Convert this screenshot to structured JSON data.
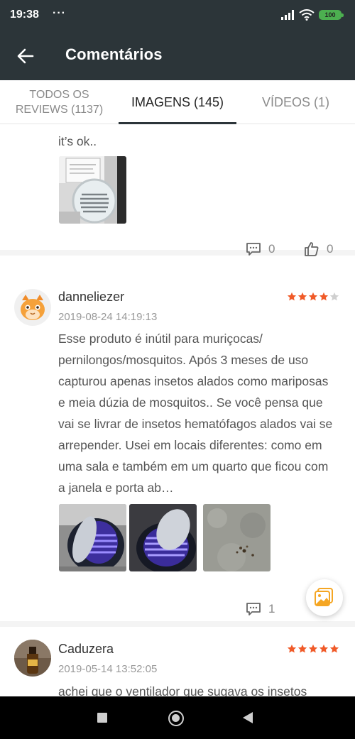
{
  "status_bar": {
    "time": "19:38",
    "dots": "···",
    "battery": "100"
  },
  "app_bar": {
    "title": "Comentários"
  },
  "tabs": {
    "all": {
      "line1": "TODOS OS",
      "line2": "REVIEWS (1137)"
    },
    "images": "IMAGENS (145)",
    "videos": "VÍDEOS (1)",
    "selected": "images"
  },
  "reviews": [
    {
      "text": "it’s ok..",
      "images": [
        "fan-on-desk-photo"
      ],
      "comments": "0",
      "likes": "0"
    },
    {
      "name": "danneliezer",
      "date": "2019-08-24 14:19:13",
      "rating": 4,
      "text": "Esse produto é inútil para muriçocas/ pernilongos/mosquitos. Após 3 meses de uso capturou apenas insetos alados como mariposas e meia dúzia de mosquitos.. Se você pensa que vai se livrar de insetos hematófagos alados vai se arrepender. Usei em locais diferentes: como em uma sala e também em um quarto que ficou com a janela e porta ab…",
      "images": [
        "lamp-uv-photo-1",
        "lamp-uv-photo-2",
        "captured-insects-photo"
      ],
      "comments": "1",
      "likes": ""
    },
    {
      "name": "Caduzera",
      "date": "2019-05-14 13:52:05",
      "rating": 5,
      "text": "achei que o ventilador que sugava os insetos"
    }
  ],
  "colors": {
    "header": "#2c3539",
    "star_active": "#f05a28",
    "star_inactive": "#cfcfcf",
    "fab_icon": "#f5a623"
  }
}
